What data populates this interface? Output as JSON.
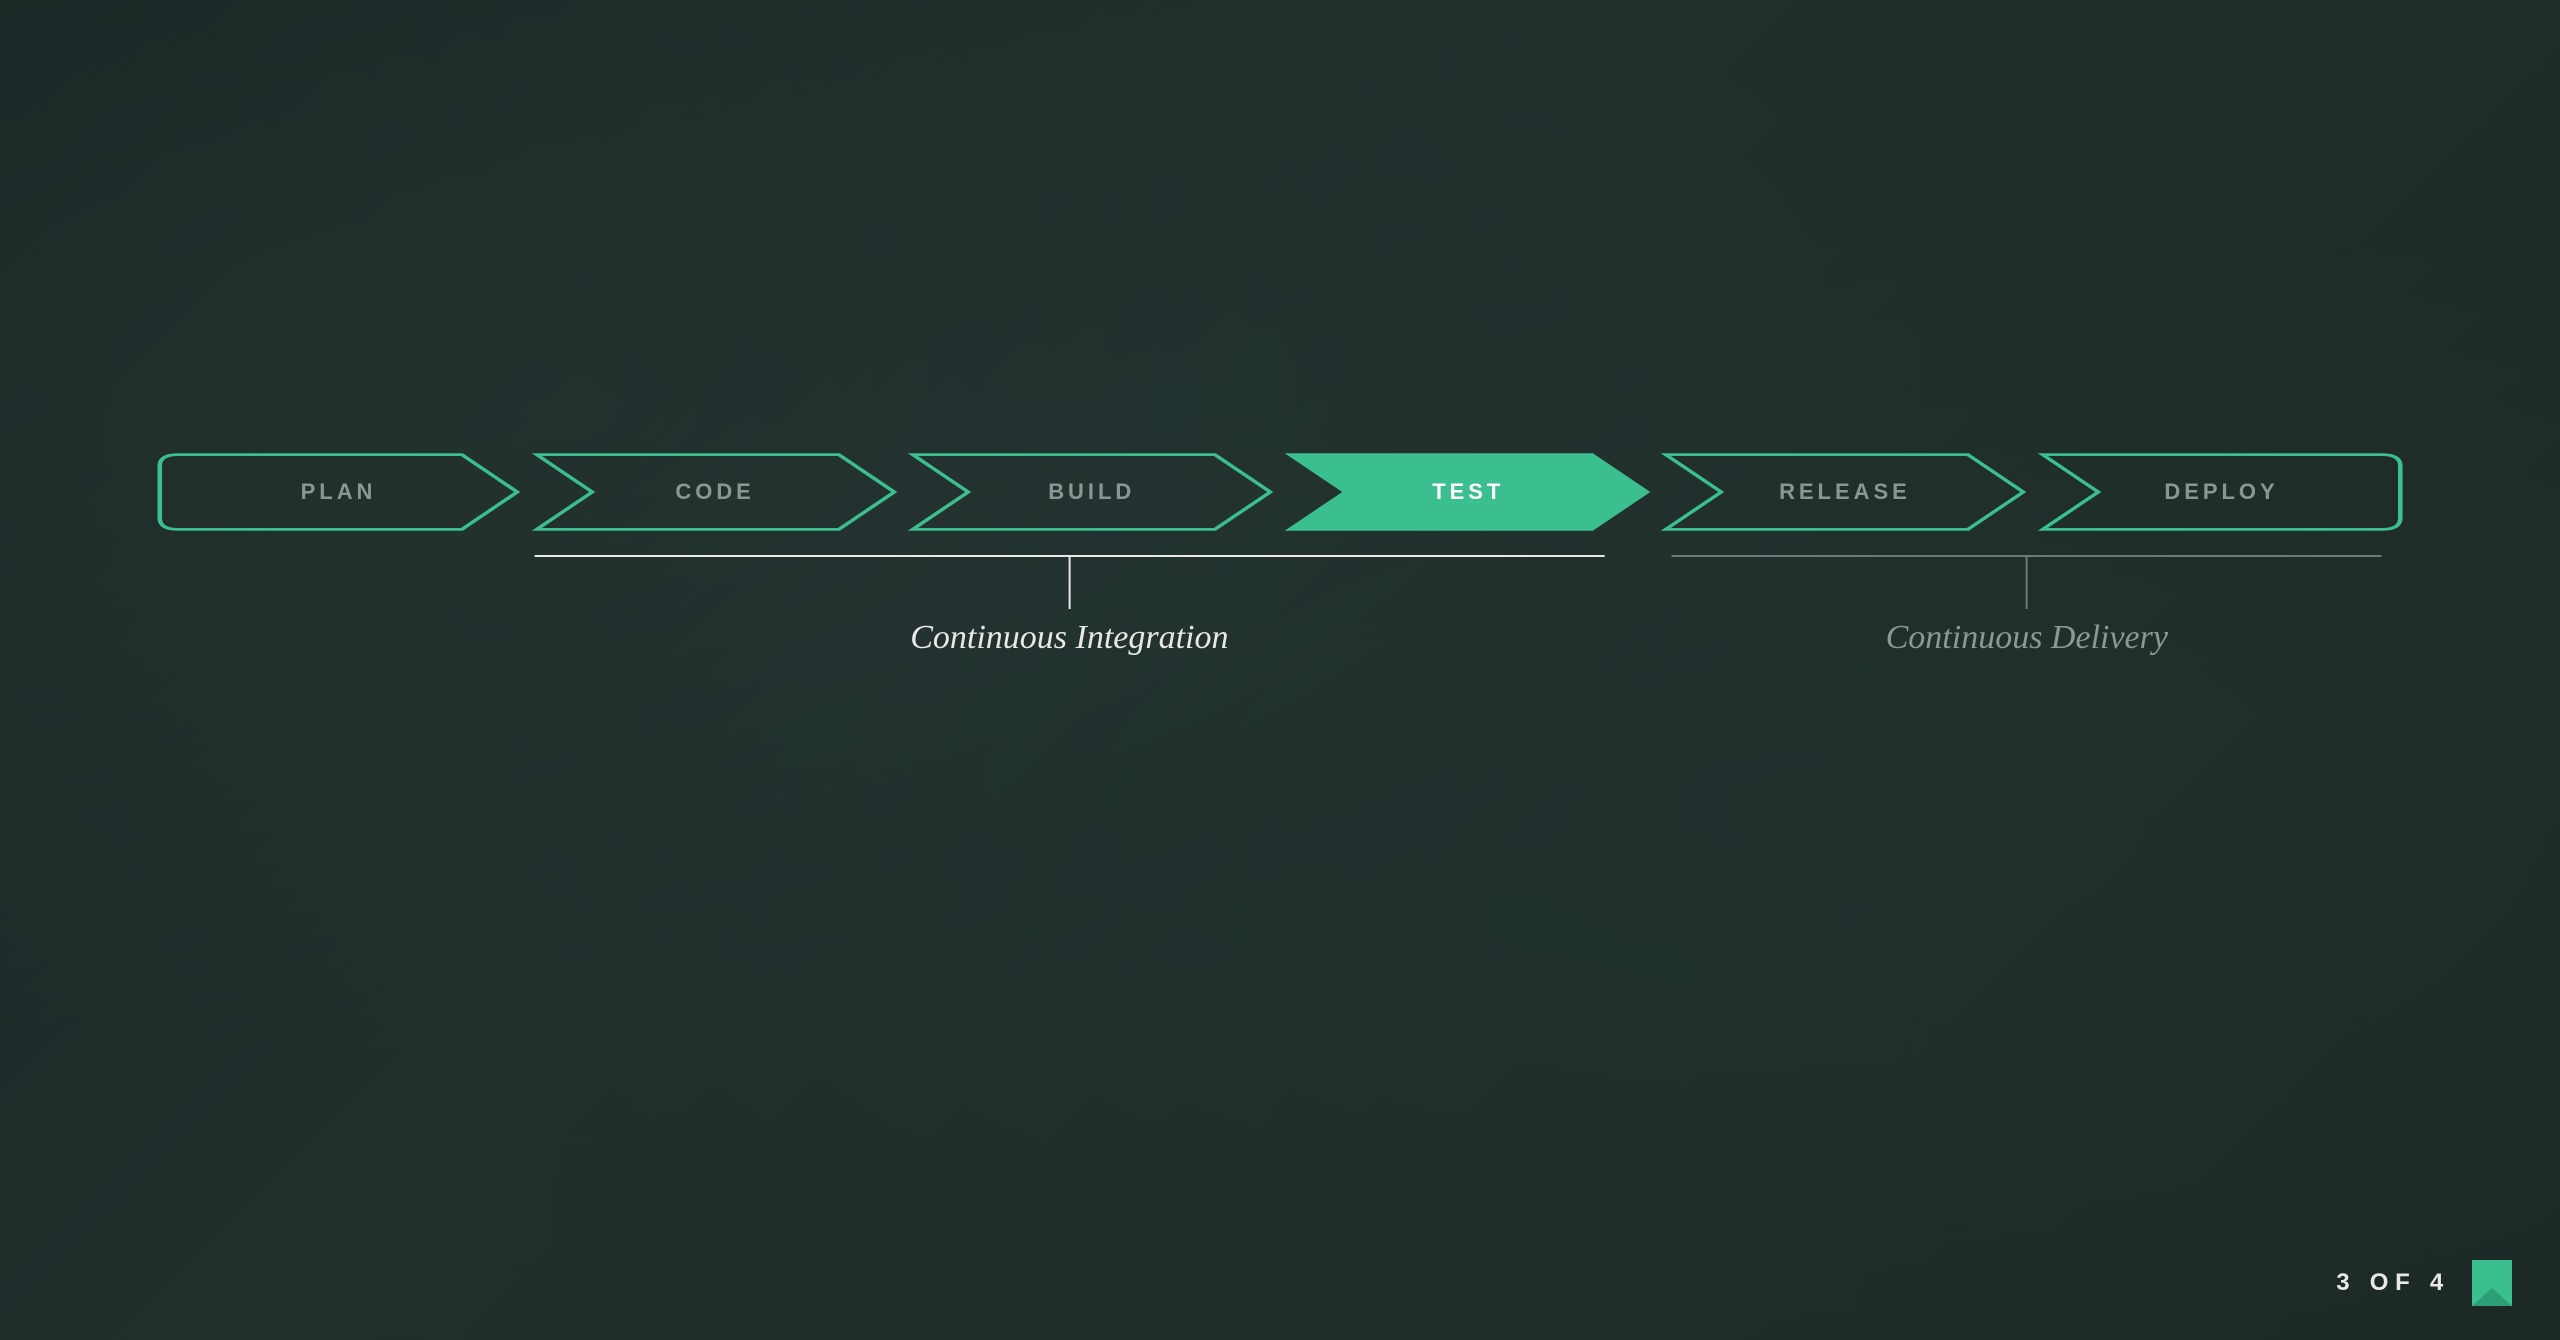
{
  "accent": "#3bbf8f",
  "pipeline": {
    "stages": [
      {
        "label": "PLAN",
        "highlighted": false,
        "shape": "start"
      },
      {
        "label": "CODE",
        "highlighted": false,
        "shape": "mid"
      },
      {
        "label": "BUILD",
        "highlighted": false,
        "shape": "mid"
      },
      {
        "label": "TEST",
        "highlighted": true,
        "shape": "mid"
      },
      {
        "label": "RELEASE",
        "highlighted": false,
        "shape": "mid"
      },
      {
        "label": "DEPLOY",
        "highlighted": false,
        "shape": "end"
      }
    ],
    "groups": [
      {
        "label": "Continuous Integration",
        "from": 1,
        "to": 3,
        "active": true
      },
      {
        "label": "Continuous Delivery",
        "from": 4,
        "to": 5,
        "active": false
      }
    ]
  },
  "pager": {
    "current": "3",
    "separator": "OF",
    "total": "4"
  }
}
